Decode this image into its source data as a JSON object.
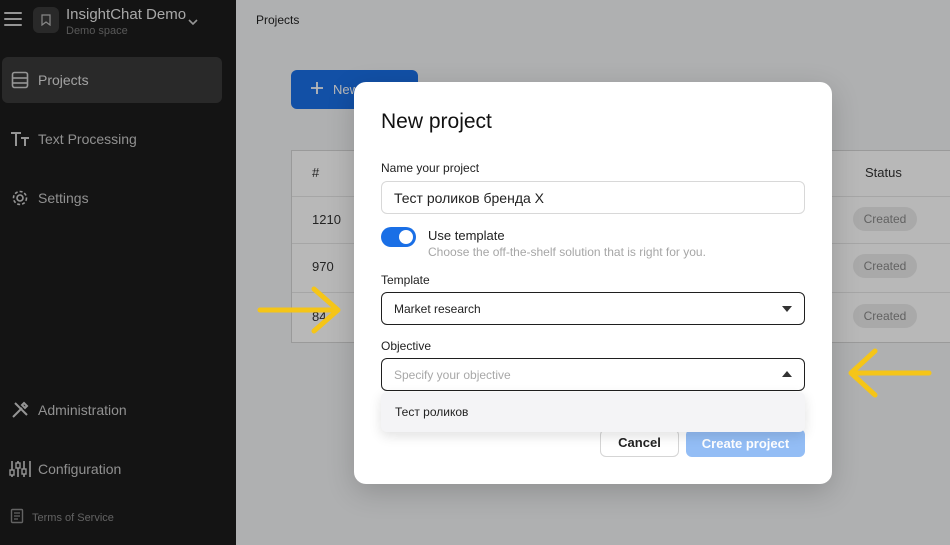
{
  "workspace": {
    "title": "InsightChat Demo",
    "subtitle": "Demo space"
  },
  "sidebar": {
    "items": [
      {
        "label": "Projects",
        "icon": "table-icon",
        "active": true
      },
      {
        "label": "Text Processing",
        "icon": "text-icon",
        "active": false
      },
      {
        "label": "Settings",
        "icon": "gear-icon",
        "active": false
      }
    ],
    "bottom_items": [
      {
        "label": "Administration",
        "icon": "tools-icon"
      },
      {
        "label": "Configuration",
        "icon": "sliders-icon"
      }
    ],
    "terms": "Terms of Service"
  },
  "main": {
    "breadcrumb": "Projects",
    "new_button": "New",
    "table": {
      "col_num": "#",
      "col_status": "Status",
      "rows": [
        {
          "num": "1210",
          "status": "Created"
        },
        {
          "num": "970",
          "status": "Created"
        },
        {
          "num": "84",
          "status": "Created"
        }
      ]
    }
  },
  "modal": {
    "title": "New project",
    "name_label": "Name your project",
    "name_value": "Тест роликов бренда X",
    "use_template_label": "Use template",
    "use_template_desc": "Choose the off-the-shelf solution that is right for you.",
    "use_template_on": true,
    "template_label": "Template",
    "template_value": "Market research",
    "objective_label": "Objective",
    "objective_placeholder": "Specify your objective",
    "objective_options": [
      "Тест роликов"
    ],
    "cancel": "Cancel",
    "create": "Create project"
  },
  "colors": {
    "accent": "#1a6fe6",
    "annotation": "#f5c518",
    "sidebar_bg": "#1c1c1c"
  }
}
